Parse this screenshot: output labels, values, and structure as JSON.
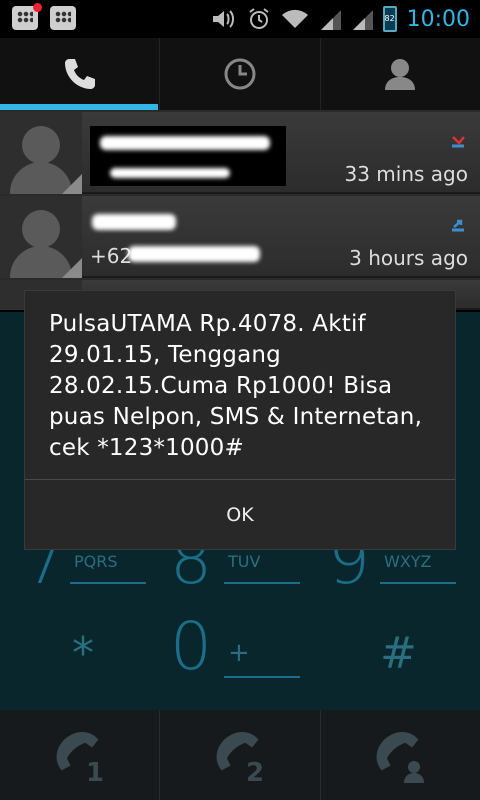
{
  "status_bar": {
    "time": "10:00",
    "battery_label": "82",
    "icons": [
      "bbm-icon",
      "bbm-icon",
      "volume-icon",
      "alarm-icon",
      "wifi-icon",
      "signal-icon",
      "signal-icon",
      "battery-icon"
    ]
  },
  "tabs": [
    {
      "name": "phone",
      "icon": "phone-icon",
      "selected": true
    },
    {
      "name": "call-log",
      "icon": "clock-icon",
      "selected": false
    },
    {
      "name": "contacts",
      "icon": "person-icon",
      "selected": false
    }
  ],
  "call_log": [
    {
      "number": "",
      "time": "33 mins ago",
      "type": "missed"
    },
    {
      "number": "+62",
      "time": "3 hours ago",
      "type": "outgoing"
    }
  ],
  "dialpad": {
    "visible_keys": [
      {
        "digit": "7",
        "letters": "PQRS"
      },
      {
        "digit": "8",
        "letters": "TUV"
      },
      {
        "digit": "9",
        "letters": "WXYZ"
      },
      {
        "digit": "*",
        "letters": ""
      },
      {
        "digit": "0",
        "letters": "+"
      },
      {
        "digit": "#",
        "letters": ""
      }
    ]
  },
  "call_buttons": [
    {
      "icon": "call-sim1-icon",
      "label": "1"
    },
    {
      "icon": "call-sim2-icon",
      "label": "2"
    },
    {
      "icon": "call-contact-icon",
      "label": ""
    }
  ],
  "dialog": {
    "message": "PulsaUTAMA Rp.4078. Aktif 29.01.15, Tenggang 28.02.15.Cuma Rp1000! Bisa puas Nelpon, SMS & Internetan, cek *123*1000#",
    "ok_label": "OK"
  },
  "colors": {
    "accent": "#33b5e5",
    "dialog_bg": "#282828",
    "dim_bg": "#09262d"
  }
}
